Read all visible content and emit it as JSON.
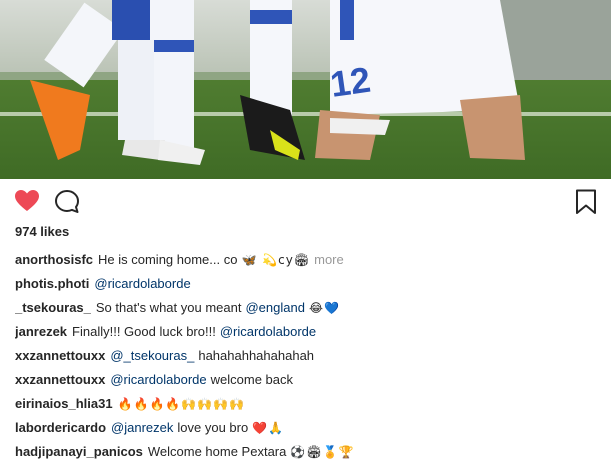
{
  "post": {
    "likes": "974 likes",
    "icons": {
      "like": "heart-icon",
      "comment": "comment-icon",
      "save": "bookmark-icon",
      "like_color": "#ed4956"
    }
  },
  "comments": [
    {
      "user": "anorthosisfc",
      "text": "He is coming home... co",
      "emojis": "🦋 💫cy🏟",
      "more": "more"
    },
    {
      "user": "photis.photi",
      "mention": "@ricardolaborde"
    },
    {
      "user": "_tsekouras_",
      "text": "So that's what you meant",
      "mention": "@england",
      "emojis": "😂💙"
    },
    {
      "user": "janrezek",
      "text": "Finally!!! Good luck bro!!!",
      "mention": "@ricardolaborde"
    },
    {
      "user": "xxzannettouxx",
      "mention": "@_tsekouras_",
      "text_after": "hahahahhahahahah"
    },
    {
      "user": "xxzannettouxx",
      "mention": "@ricardolaborde",
      "text_after": "welcome back"
    },
    {
      "user": "eirinaios_hlia31",
      "emojis": "🔥🔥🔥🔥🙌🙌🙌🙌"
    },
    {
      "user": "labordericardo",
      "mention": "@janrezek",
      "text_after": "love you bro",
      "emojis": "❤️🙏"
    },
    {
      "user": "hadjipanayi_panicos",
      "text": "Welcome home Pextara",
      "emojis": "⚽🏟🏅🏆"
    }
  ]
}
